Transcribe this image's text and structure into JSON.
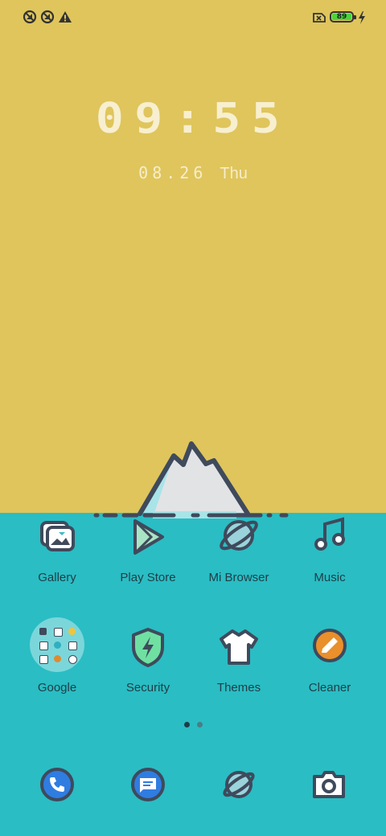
{
  "status_bar": {
    "left_icons": [
      "signal-off-icon",
      "signal-off-icon",
      "warning-icon"
    ],
    "right_icons": [
      "no-sim-icon",
      "battery-icon",
      "charging-icon"
    ],
    "battery_percent": "89"
  },
  "lockscreen": {
    "time": "09:55",
    "date": "08.26",
    "weekday": "Thu"
  },
  "apps": [
    {
      "label": "Gallery"
    },
    {
      "label": "Play Store"
    },
    {
      "label": "Mi Browser"
    },
    {
      "label": "Music"
    },
    {
      "label": "Google"
    },
    {
      "label": "Security"
    },
    {
      "label": "Themes"
    },
    {
      "label": "Cleaner"
    }
  ],
  "pager": {
    "pages": 2,
    "current": 1
  },
  "dock": [
    "phone-icon",
    "messages-icon",
    "browser-icon",
    "camera-icon"
  ],
  "colors": {
    "sky": "#dfc55c",
    "sea": "#2abdc4",
    "ink": "#3f4a5c"
  }
}
